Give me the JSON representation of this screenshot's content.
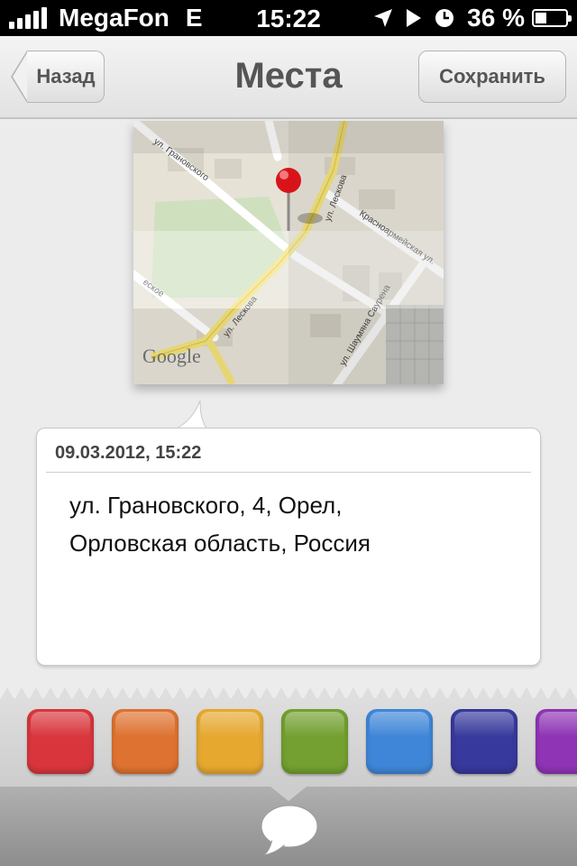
{
  "status_bar": {
    "carrier": "MegaFon",
    "network": "E",
    "time": "15:22",
    "battery_percent": "36 %",
    "battery_level": 0.36,
    "icons": [
      "signal-icon",
      "location-arrow-icon",
      "play-icon",
      "clock-icon",
      "battery-icon"
    ]
  },
  "nav": {
    "title": "Места",
    "back_label": "Назад",
    "save_label": "Сохранить"
  },
  "map": {
    "provider_logo": "Google",
    "streets": {
      "granovskogo": "ул. Грановского",
      "leskova_top": "ул. Лескова",
      "leskova_bottom": "ул. Лескова",
      "krasnoarmeyskaya": "Красноармейская ул.",
      "shaumyana": "ул. Шаумяна Саурена",
      "partial_left": "еское"
    },
    "marker": "map-pin-icon"
  },
  "note": {
    "date": "09.03.2012, 15:22",
    "address_line1": "ул. Грановского, 4, Орел,",
    "address_line2": "Орловская область, Россия"
  },
  "palette": {
    "colors": [
      {
        "name": "red",
        "hex": "#d8363c"
      },
      {
        "name": "orange",
        "hex": "#de7230"
      },
      {
        "name": "yellow",
        "hex": "#e6a82f"
      },
      {
        "name": "green",
        "hex": "#73a030"
      },
      {
        "name": "blue",
        "hex": "#3f86d8"
      },
      {
        "name": "indigo",
        "hex": "#37399c"
      },
      {
        "name": "purple",
        "hex": "#8e34b4"
      }
    ]
  },
  "toolbar": {
    "icon": "speech-bubble-icon"
  }
}
